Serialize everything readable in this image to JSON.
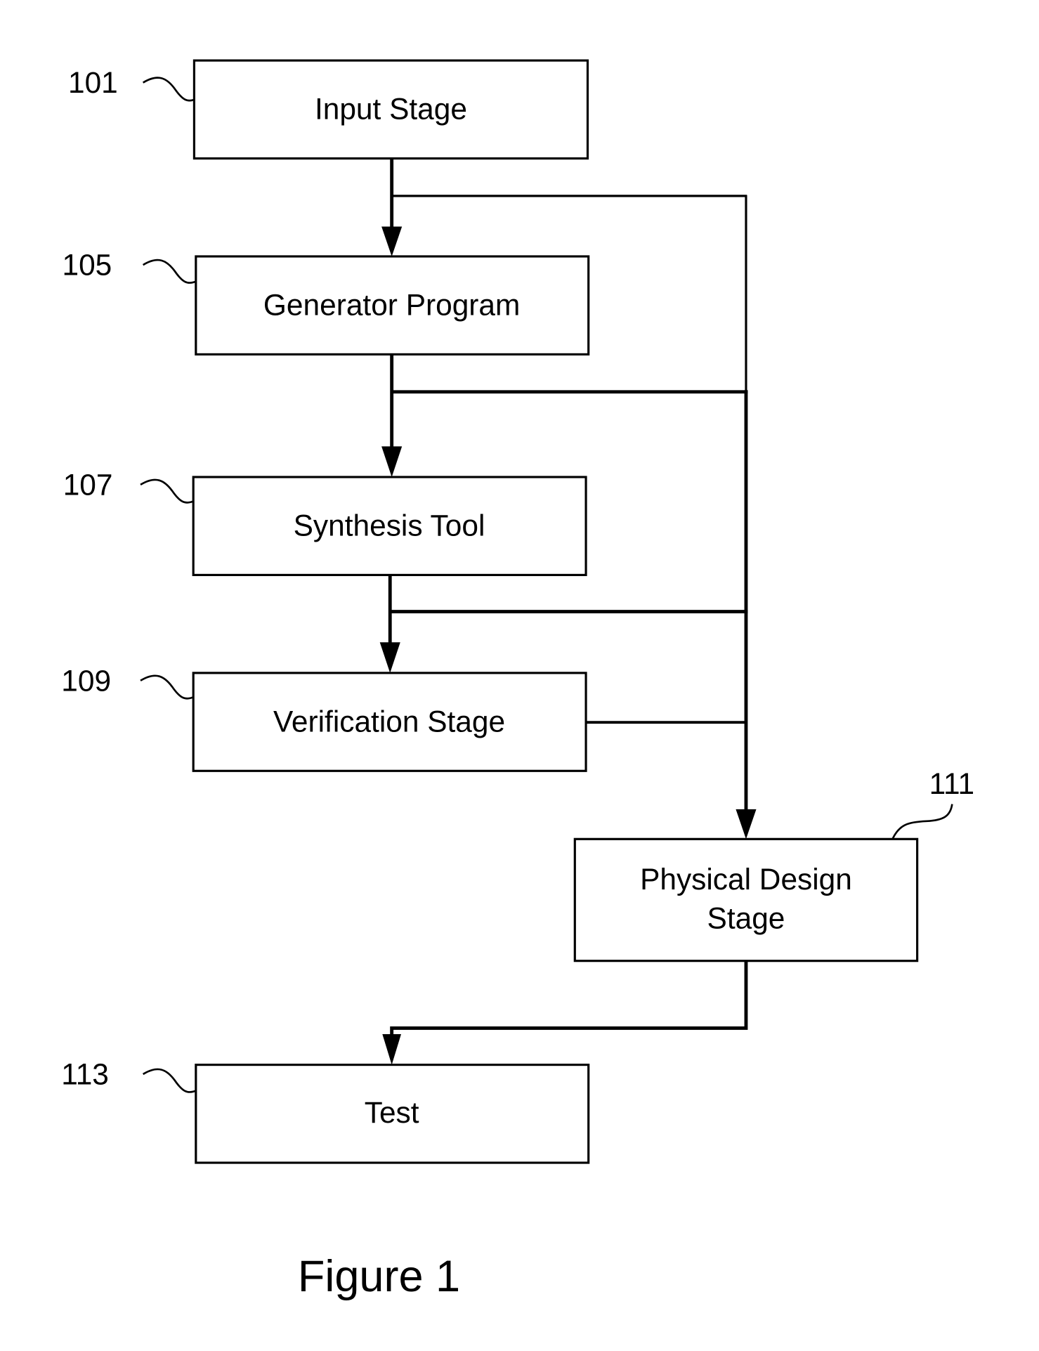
{
  "figure": {
    "caption": "Figure 1",
    "stroke_color": "#000000",
    "background_color": "#ffffff"
  },
  "nodes": [
    {
      "id": "input",
      "ref": "101",
      "lines": [
        "Input Stage"
      ]
    },
    {
      "id": "generator",
      "ref": "105",
      "lines": [
        "Generator Program"
      ]
    },
    {
      "id": "synthesis",
      "ref": "107",
      "lines": [
        "Synthesis Tool"
      ]
    },
    {
      "id": "verification",
      "ref": "109",
      "lines": [
        "Verification Stage"
      ]
    },
    {
      "id": "physical",
      "ref": "111",
      "lines": [
        "Physical Design",
        "Stage"
      ]
    },
    {
      "id": "test",
      "ref": "113",
      "lines": [
        "Test"
      ]
    }
  ],
  "edges": [
    {
      "from": "input",
      "to": "generator",
      "arrow": true
    },
    {
      "from": "input",
      "to": "physical",
      "arrow": true
    },
    {
      "from": "generator",
      "to": "synthesis",
      "arrow": true
    },
    {
      "from": "generator",
      "to": "physical",
      "arrow": true
    },
    {
      "from": "synthesis",
      "to": "verification",
      "arrow": true
    },
    {
      "from": "synthesis",
      "to": "physical",
      "arrow": true
    },
    {
      "from": "verification",
      "to": "physical",
      "arrow": true
    },
    {
      "from": "physical",
      "to": "test",
      "arrow": true
    }
  ]
}
